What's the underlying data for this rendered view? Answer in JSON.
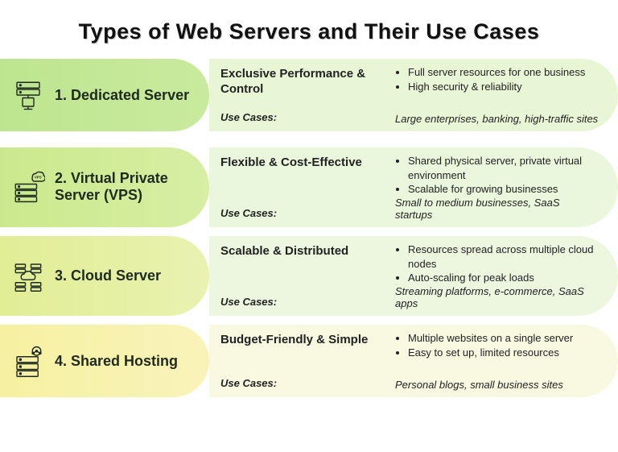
{
  "title": "Types of Web Servers and Their Use Cases",
  "use_cases_label": "Use Cases:",
  "rows": [
    {
      "pill": "1. Dedicated Server",
      "icon": "dedicated-server-icon",
      "heading": "Exclusive Performance & Control",
      "bullets": [
        "Full server resources for one business",
        "High security & reliability"
      ],
      "use_cases": "Large enterprises, banking, high-traffic sites"
    },
    {
      "pill": "2. Virtual Private Server (VPS)",
      "icon": "vps-icon",
      "heading": "Flexible & Cost-Effective",
      "bullets": [
        "Shared physical server, private virtual environment",
        "Scalable for growing businesses"
      ],
      "use_cases": "Small to medium businesses, SaaS startups"
    },
    {
      "pill": "3. Cloud Server",
      "icon": "cloud-server-icon",
      "heading": "Scalable & Distributed",
      "bullets": [
        "Resources spread across multiple cloud nodes",
        "Auto-scaling for peak loads"
      ],
      "use_cases": "Streaming platforms, e-commerce, SaaS apps"
    },
    {
      "pill": "4. Shared Hosting",
      "icon": "shared-hosting-icon",
      "heading": "Budget-Friendly & Simple",
      "bullets": [
        "Multiple websites on a single server",
        "Easy to set up, limited resources"
      ],
      "use_cases": "Personal blogs, small business sites"
    }
  ]
}
